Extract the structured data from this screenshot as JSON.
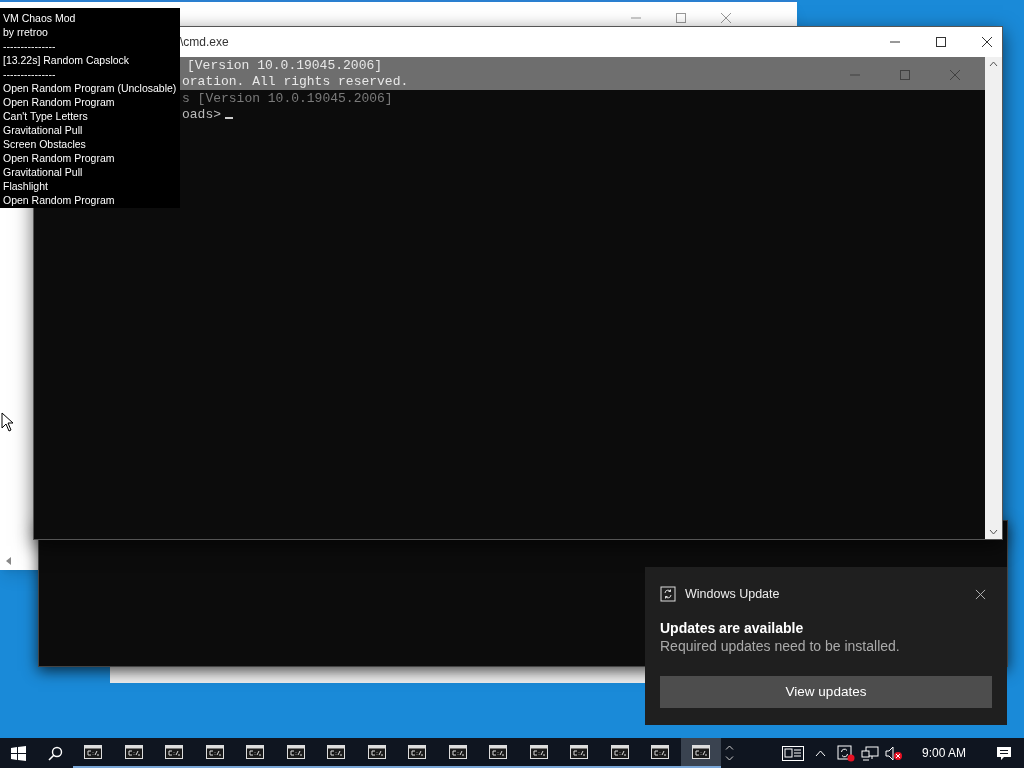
{
  "overlay": {
    "title": "VM Chaos Mod",
    "author": "by rretroo",
    "separator_top": "---------------",
    "current_effect": "[13.22s] Random Capslock",
    "separator_bottom": "---------------",
    "effects": [
      "Open Random Program (Unclosable)",
      "Open Random Program",
      "Can't Type Letters",
      "Gravitational Pull",
      "Screen Obstacles",
      "Open Random Program",
      "Gravitational Pull",
      "Flashlight",
      "Open Random Program"
    ]
  },
  "console_window": {
    "title": "\\cmd.exe",
    "highlighted_lines": [
      "[Version 10.0.19045.2006]",
      "oration. All rights reserved."
    ],
    "ghost_line": "s [Version 10.0.19045.2006]",
    "prompt": "oads>"
  },
  "toast": {
    "app": "Windows Update",
    "title": "Updates are available",
    "body": "Required updates need to be installed.",
    "button": "View updates"
  },
  "taskbar": {
    "apps": [
      {
        "selected": false
      },
      {
        "selected": false
      },
      {
        "selected": false
      },
      {
        "selected": false
      },
      {
        "selected": false
      },
      {
        "selected": false
      },
      {
        "selected": false
      },
      {
        "selected": false
      },
      {
        "selected": false
      },
      {
        "selected": false
      },
      {
        "selected": false
      },
      {
        "selected": false
      },
      {
        "selected": false
      },
      {
        "selected": false
      },
      {
        "selected": false
      },
      {
        "selected": true
      }
    ],
    "clock": "9:00 AM"
  }
}
